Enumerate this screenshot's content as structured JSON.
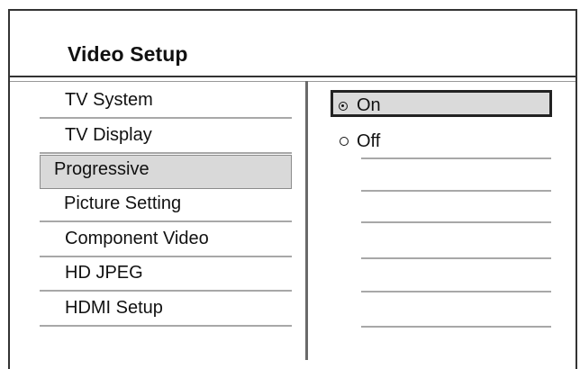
{
  "header": {
    "title": "Video Setup"
  },
  "menu": {
    "items": [
      {
        "label": "TV System"
      },
      {
        "label": "TV Display"
      },
      {
        "label": "Progressive"
      },
      {
        "label": "Picture Setting"
      },
      {
        "label": "Component Video"
      },
      {
        "label": "HD JPEG"
      },
      {
        "label": "HDMI Setup"
      }
    ],
    "selected_label": "Progressive"
  },
  "options": {
    "items": [
      {
        "label": "On",
        "selected": true
      },
      {
        "label": "Off",
        "selected": false
      }
    ],
    "empty_slots": 6
  }
}
